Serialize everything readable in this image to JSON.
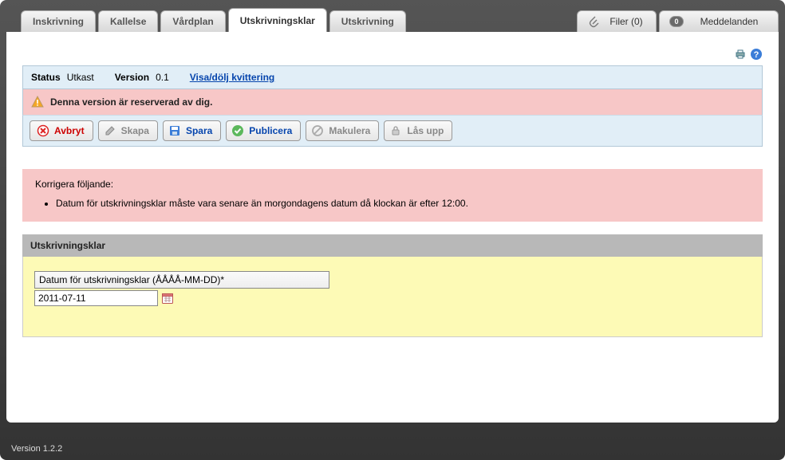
{
  "tabs": {
    "inskrivning": "Inskrivning",
    "kallelse": "Kallelse",
    "vardplan": "Vårdplan",
    "utskrivningsklar": "Utskrivningsklar",
    "utskrivning": "Utskrivning"
  },
  "top_right": {
    "files_label": "Filer (0)",
    "messages_label": "Meddelanden",
    "messages_badge": "0"
  },
  "status_bar": {
    "status_label": "Status",
    "status_value": "Utkast",
    "version_label": "Version",
    "version_value": "0.1",
    "toggle_link": "Visa/dölj kvittering"
  },
  "reserved_alert": "Denna version är reserverad av dig.",
  "buttons": {
    "avbryt": "Avbryt",
    "skapa": "Skapa",
    "spara": "Spara",
    "publicera": "Publicera",
    "makulera": "Makulera",
    "lasupp": "Lås upp"
  },
  "validation": {
    "heading": "Korrigera följande:",
    "items": [
      "Datum för utskrivningsklar måste vara senare än morgondagens datum då klockan är efter 12:00."
    ]
  },
  "section": {
    "title": "Utskrivningsklar",
    "field_label": "Datum för utskrivningsklar (ÅÅÅÅ-MM-DD)*",
    "date_value": "2011-07-11"
  },
  "footer": {
    "version": "Version 1.2.2"
  }
}
